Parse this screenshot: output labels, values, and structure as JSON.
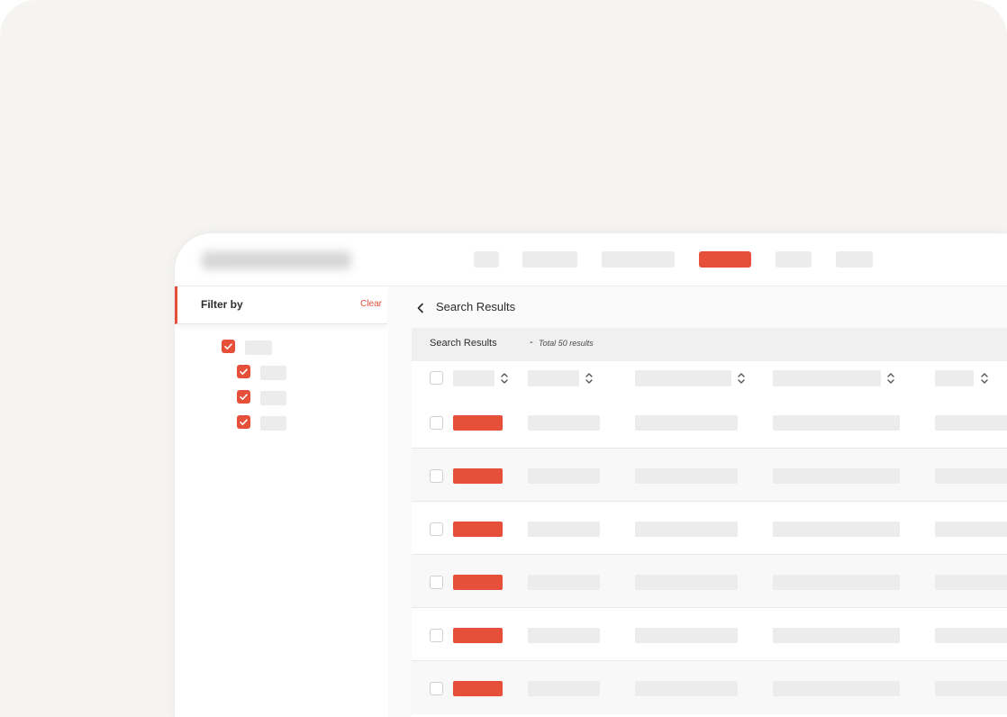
{
  "colors": {
    "accent": "#e6503a",
    "skeleton": "#ececec",
    "background": "#f5f4f1"
  },
  "nav": {
    "logo": "blurred-logo",
    "items": [
      {
        "name": "nav-item-1",
        "active": false
      },
      {
        "name": "nav-item-2",
        "active": false
      },
      {
        "name": "nav-item-3",
        "active": false
      },
      {
        "name": "nav-item-4",
        "active": true
      },
      {
        "name": "nav-item-5",
        "active": false
      },
      {
        "name": "nav-item-6",
        "active": false
      }
    ]
  },
  "sidebar": {
    "title": "Filter by",
    "clear_label": "Clear",
    "filters": [
      {
        "checked": true,
        "level": 0
      },
      {
        "checked": true,
        "level": 1
      },
      {
        "checked": true,
        "level": 1
      },
      {
        "checked": true,
        "level": 1
      }
    ]
  },
  "main": {
    "title": "Search Results",
    "results_label": "Search Results",
    "results_separator": "-",
    "results_total": "Total 50 results"
  },
  "table": {
    "column_count": 5,
    "row_count": 6,
    "icons": {
      "back": "chevron-left-icon",
      "sort": "sort-icon",
      "check": "check-icon"
    }
  }
}
